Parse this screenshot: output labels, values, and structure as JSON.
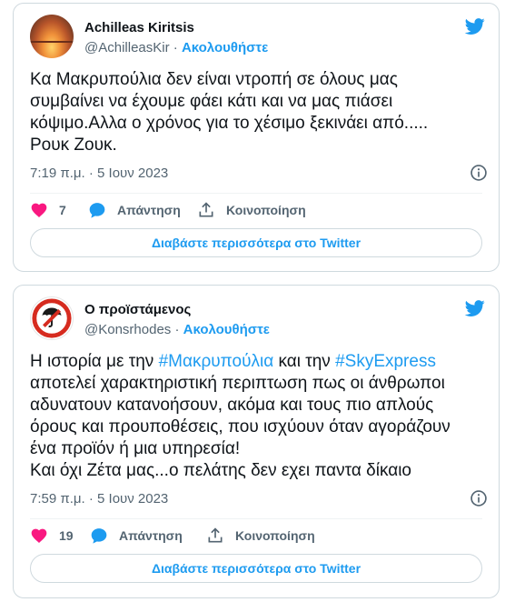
{
  "colors": {
    "accent": "#1d9bf0",
    "like": "#f91880",
    "muted": "#536471",
    "text": "#0f1419"
  },
  "tweets": [
    {
      "author_name": "Achilleas Kiritsis",
      "handle": "@AchilleasKir",
      "separator": "·",
      "follow_label": "Ακολουθήστε",
      "text_parts": [
        {
          "text": "Κα Μακρυπούλια δεν είναι ντροπή σε όλους μας\nσυμβαίνει να έχουμε φάει κάτι και να μας πιάσει\nκόψιμο.Αλλα ο χρόνος για το χέσιμο ξεκινάει από.....\nΡουκ Ζουκ."
        }
      ],
      "timestamp": "7:19 π.μ. · 5 Ιουν 2023",
      "likes": "7",
      "reply_label": "Απάντηση",
      "share_label": "Κοινοποίηση",
      "read_more": "Διαβάστε περισσότερα στο Twitter",
      "avatar_icon": "sunset-avatar-icon"
    },
    {
      "author_name": "Ο προϊστάμενος",
      "handle": "@Konsrhodes",
      "separator": "·",
      "follow_label": "Ακολουθήστε",
      "text_parts": [
        {
          "text": "Η ιστορία με την "
        },
        {
          "text": "#Μακρυπούλια",
          "hashtag": true
        },
        {
          "text": " και την "
        },
        {
          "text": "#SkyExpress",
          "hashtag": true
        },
        {
          "text": "\nαποτελεί χαρακτηριστική περιπτωση πως οι άνθρωποι\nαδυνατουν κατανοήσουν, ακόμα και τους πιο απλούς\nόρους και προυποθέσεις, που ισχύουν όταν αγοράζουν\nένα προϊόν ή μια υπηρεσία!\nΚαι όχι Ζέτα μας...ο πελάτης δεν εχει παντα δίκαιο"
        }
      ],
      "timestamp": "7:59 π.μ. · 5 Ιουν 2023",
      "likes": "19",
      "reply_label": "Απάντηση",
      "share_label": "Κοινοποίηση",
      "read_more": "Διαβάστε περισσότερα στο Twitter",
      "avatar_icon": "no-umbrella-sign-avatar-icon"
    }
  ]
}
